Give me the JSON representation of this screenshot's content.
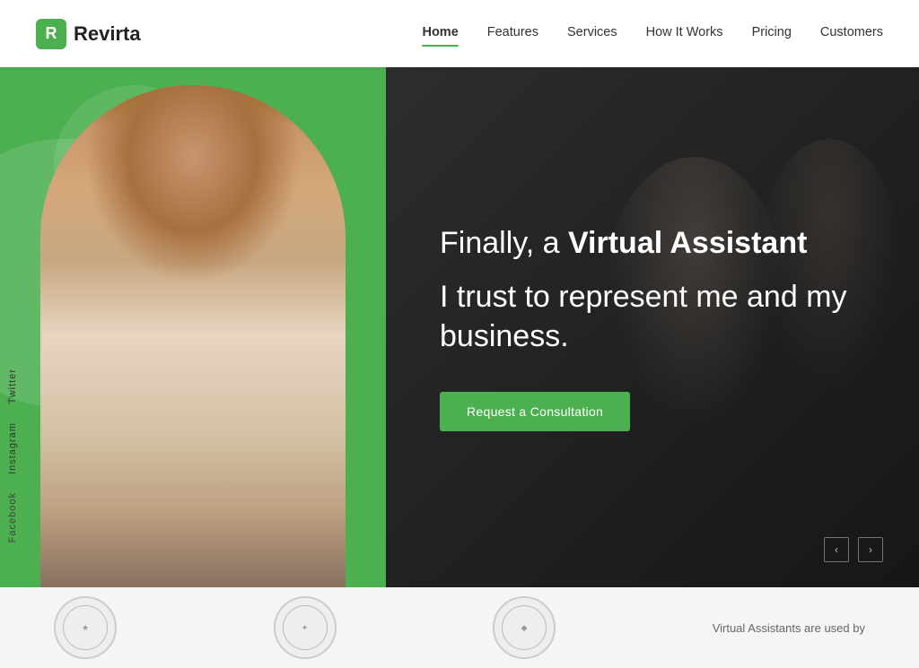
{
  "header": {
    "logo_text": "Revirta",
    "logo_symbol": "R",
    "nav": {
      "items": [
        {
          "label": "Home",
          "active": true
        },
        {
          "label": "Features",
          "active": false
        },
        {
          "label": "Services",
          "active": false
        },
        {
          "label": "How It Works",
          "active": false
        },
        {
          "label": "Pricing",
          "active": false
        },
        {
          "label": "Customers",
          "active": false
        }
      ]
    }
  },
  "hero": {
    "headline_part1": "Finally, a ",
    "headline_bold": "Virtual Assistant",
    "headline_part2": "I trust to represent me and my",
    "headline_part3": "business.",
    "cta_label": "Request a Consultation"
  },
  "social": {
    "items": [
      "Twitter",
      "Instagram",
      "Facebook"
    ]
  },
  "carousel": {
    "prev_label": "‹",
    "next_label": "›"
  },
  "bottom_strip": {
    "text": "Virtual Assistants are used by"
  }
}
